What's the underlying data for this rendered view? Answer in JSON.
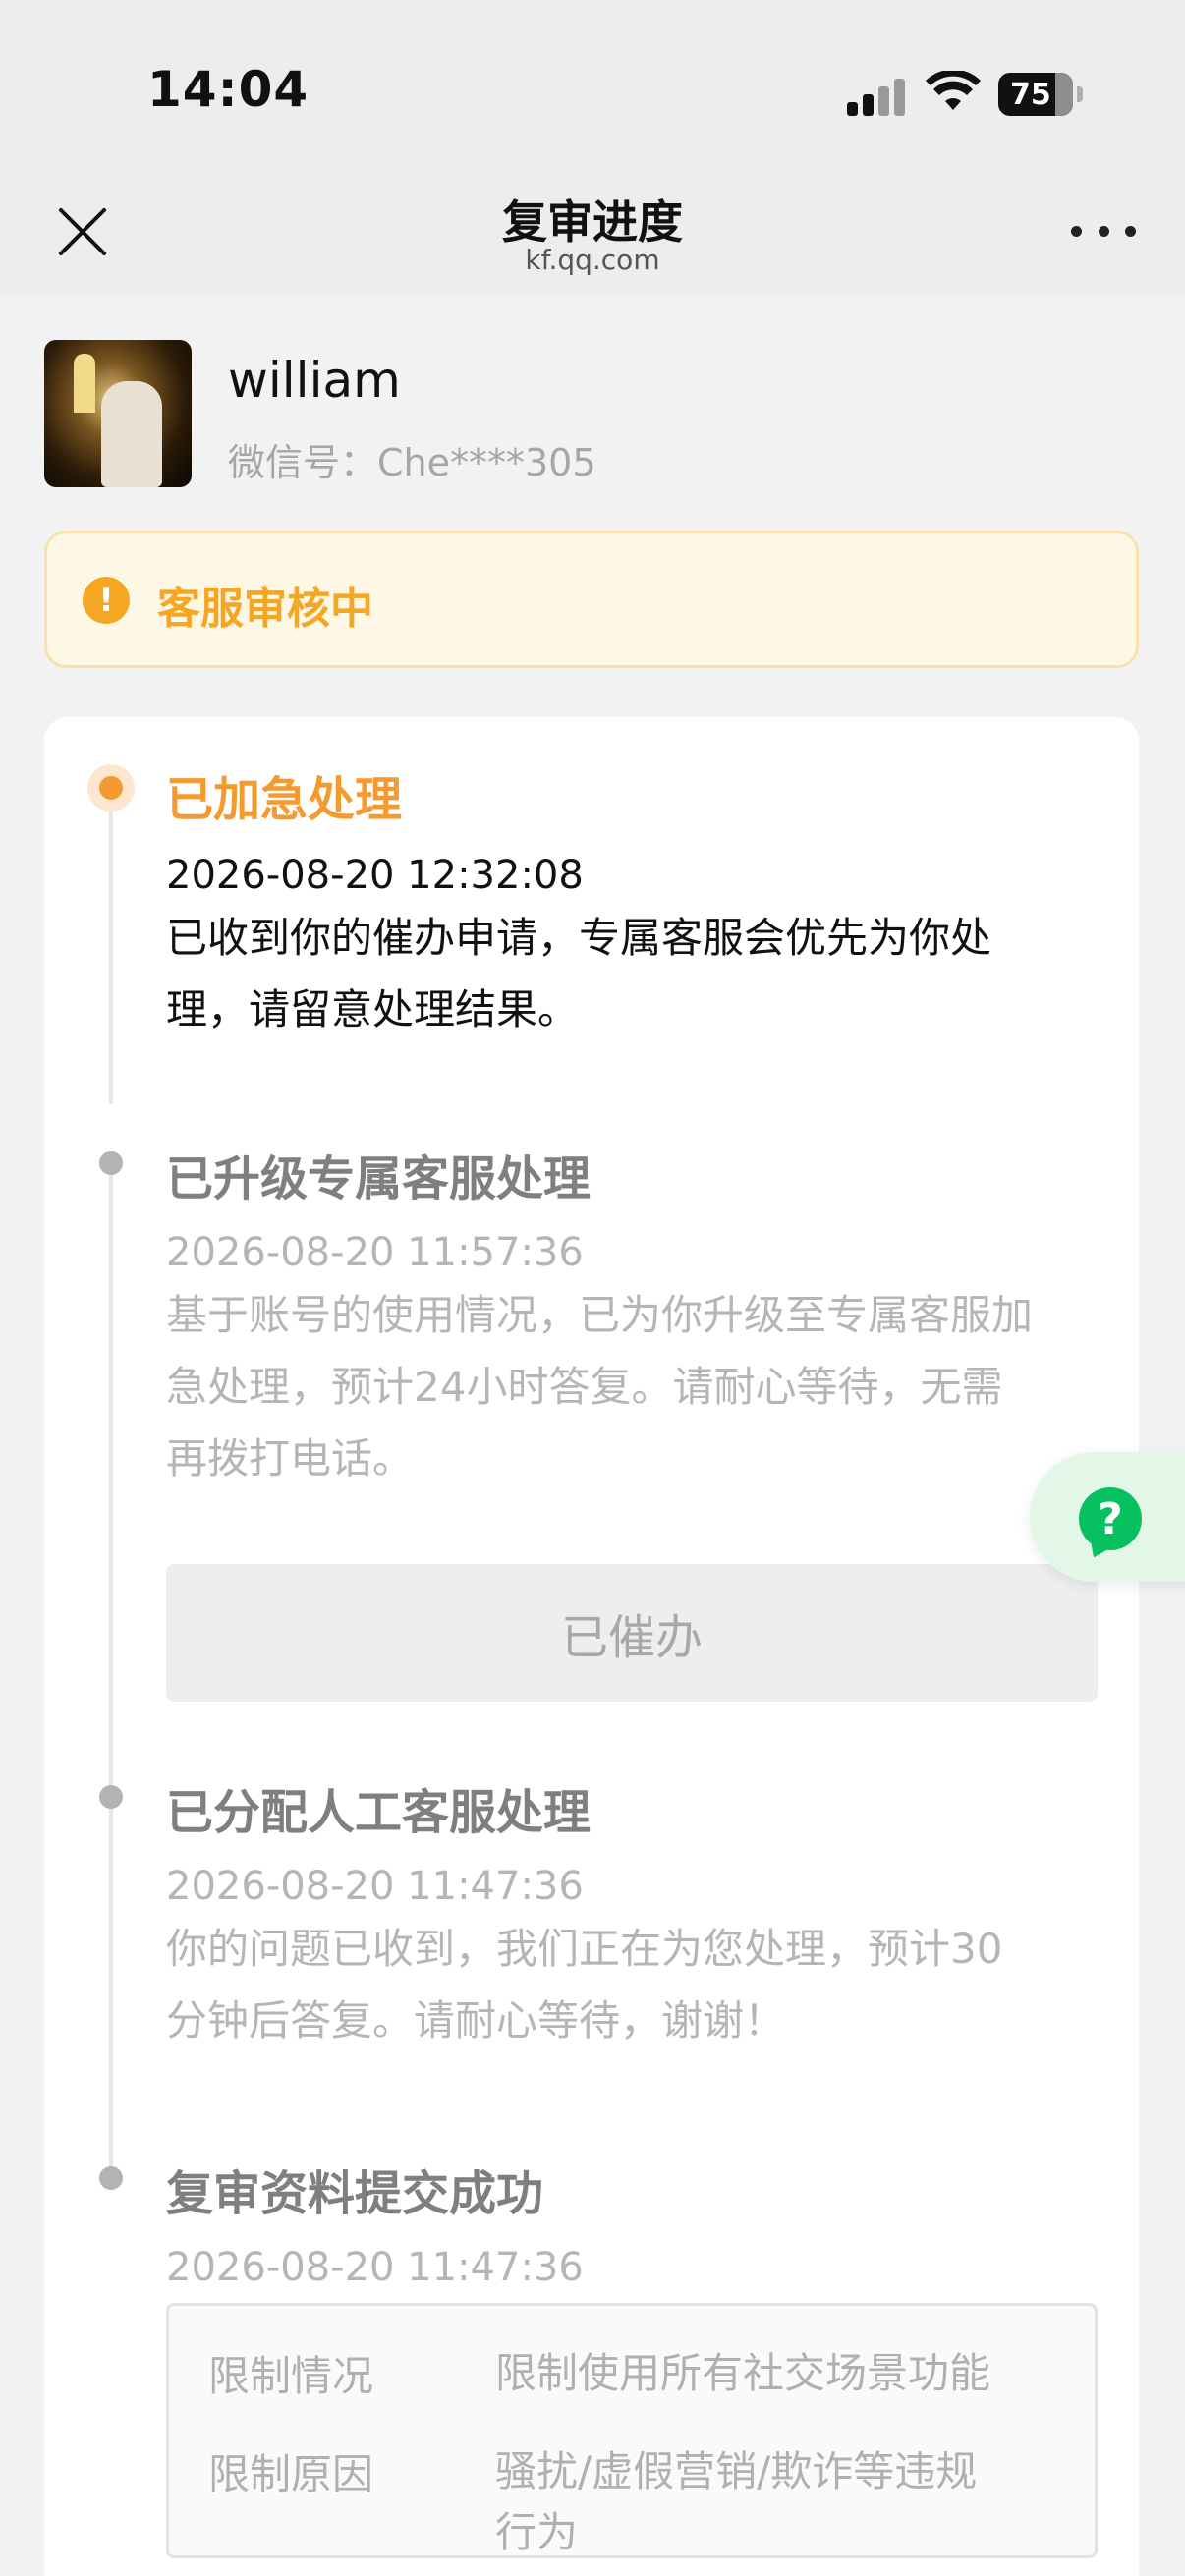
{
  "status_bar": {
    "time": "14:04",
    "battery": "75"
  },
  "nav": {
    "title": "复审进度",
    "subtitle": "kf.qq.com"
  },
  "profile": {
    "name": "william",
    "wechat_id": "微信号：Che****305"
  },
  "review_status": {
    "text": "客服审核中",
    "color": "#f5a623"
  },
  "timeline": [
    {
      "title": "已加急处理",
      "time": "2026-08-20 12:32:08",
      "desc_line1": "已收到你的催办申请，专属客服会优先为你处",
      "desc_line2": "理，请留意处理结果。",
      "active": true
    },
    {
      "title": "已升级专属客服处理",
      "time": "2026-08-20 11:57:36",
      "desc_line1": "基于账号的使用情况，已为你升级至专属客服加",
      "desc_line2": "急处理，预计24小时答复。请耐心等待，无需",
      "desc_line3": "再拨打电话。",
      "button_label": "已催办",
      "active": false
    },
    {
      "title": "已分配人工客服处理",
      "time": "2026-08-20 11:47:36",
      "desc_line1": "你的问题已收到，我们正在为您处理，预计30",
      "desc_line2": "分钟后答复。请耐心等待，谢谢！",
      "active": false
    },
    {
      "title": "复审资料提交成功",
      "time": "2026-08-20 11:47:36",
      "details": [
        {
          "label": "限制情况",
          "value": "限制使用所有社交场景功能"
        },
        {
          "label": "限制原因",
          "value_line1": "骚扰/虚假营销/欺诈等违规",
          "value_line2": "行为"
        }
      ],
      "active": false
    }
  ],
  "colors": {
    "accent_orange": "#f39b30",
    "wechat_green": "#07c160",
    "banner_bg": "#fdf7e6"
  },
  "icons": [
    "close-icon",
    "more-icon",
    "warning-icon",
    "help-icon",
    "signal-icon",
    "wifi-icon",
    "battery-icon"
  ]
}
